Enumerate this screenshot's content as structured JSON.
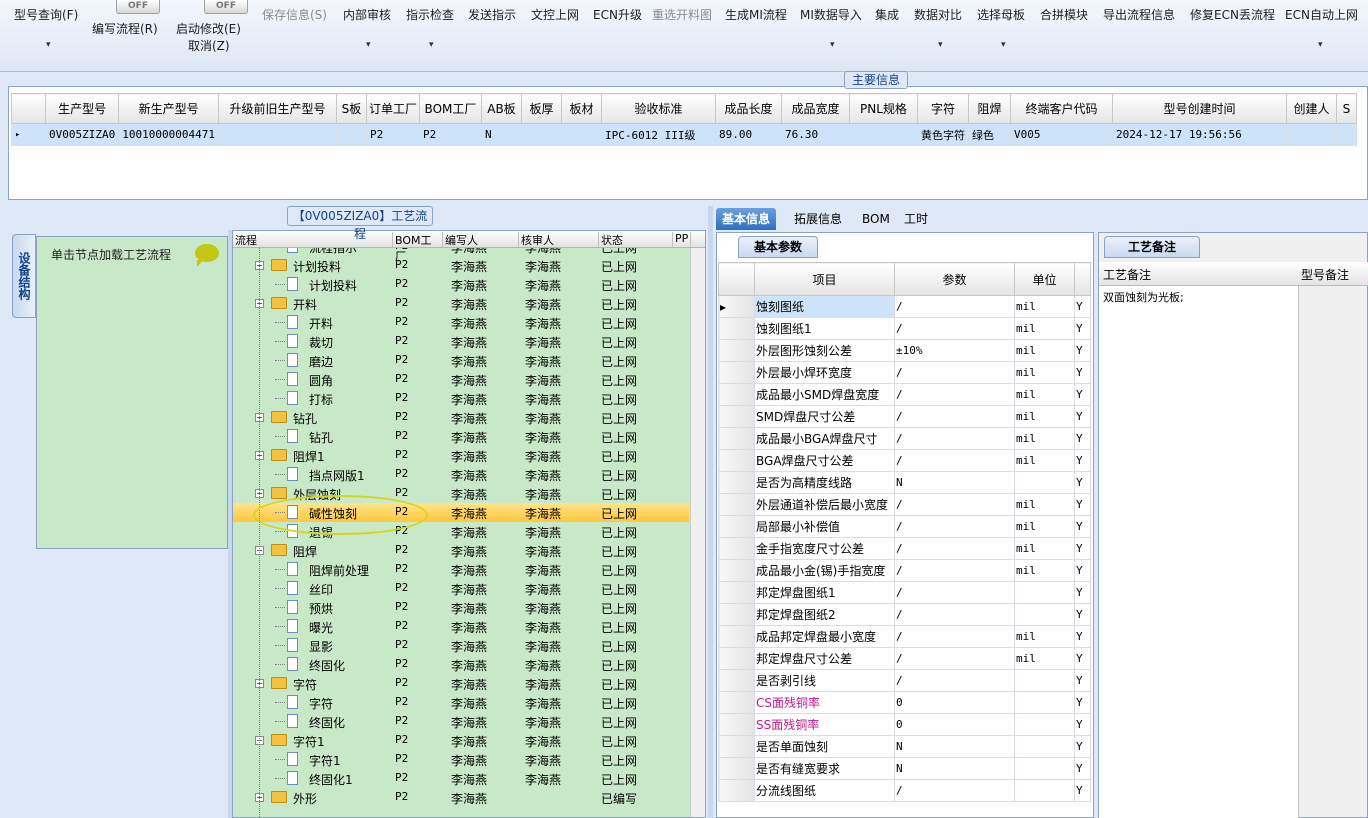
{
  "toolbar": {
    "items": [
      {
        "label": "型号查询(F)",
        "disabled": false
      },
      {
        "label": "编写流程(R)",
        "disabled": false
      },
      {
        "label": "启动修改(E)",
        "disabled": false
      },
      {
        "label": "取消(Z)",
        "disabled": false
      },
      {
        "label": "保存信息(S)",
        "disabled": true
      },
      {
        "label": "内部审核",
        "disabled": false
      },
      {
        "label": "指示检查",
        "disabled": false
      },
      {
        "label": "发送指示",
        "disabled": false
      },
      {
        "label": "文控上网",
        "disabled": false
      },
      {
        "label": "ECN升级",
        "disabled": false
      },
      {
        "label": "重选开料图",
        "disabled": true
      },
      {
        "label": "生成MI流程",
        "disabled": false
      },
      {
        "label": "MI数据导入",
        "disabled": false
      },
      {
        "label": "集成",
        "disabled": false
      },
      {
        "label": "数据对比",
        "disabled": false
      },
      {
        "label": "选择母板",
        "disabled": false
      },
      {
        "label": "合拼模块",
        "disabled": false
      },
      {
        "label": "导出流程信息",
        "disabled": false
      },
      {
        "label": "修复ECN丢流程",
        "disabled": false
      },
      {
        "label": "ECN自动上网",
        "disabled": false
      }
    ],
    "toggle_label": "OFF",
    "dropdown_glyph": "▾"
  },
  "main_info": {
    "title": "主要信息",
    "columns": [
      "生产型号",
      "新生产型号",
      "升级前旧生产型号",
      "S板",
      "订单工厂",
      "BOM工厂",
      "AB板",
      "板厚",
      "板材",
      "验收标准",
      "成品长度",
      "成品宽度",
      "PNL规格",
      "字符",
      "阻焊",
      "终端客户代码",
      "型号创建时间",
      "创建人",
      "S"
    ],
    "row": [
      "0V005ZIZA0",
      "10010000004471",
      "",
      "",
      "P2",
      "P2",
      "N",
      "",
      "",
      "IPC-6012 III级",
      "89.00",
      "76.30",
      "",
      "黄色字符",
      "绿色",
      "V005",
      "2024-12-17 19:56:56",
      "",
      ""
    ]
  },
  "process": {
    "title": "【0V005ZIZA0】工艺流程",
    "side_tab": "设备结构",
    "hint": "单击节点加载工艺流程",
    "columns": [
      "流程",
      "BOM工厂",
      "编写人",
      "核审人",
      "状态",
      "PP"
    ],
    "rows": [
      {
        "name": "流程指示",
        "type": "doc",
        "factory": "P2",
        "writer": "李海燕",
        "reviewer": "李海燕",
        "status": "已上网"
      },
      {
        "name": "计划投料",
        "type": "folder",
        "factory": "P2",
        "writer": "李海燕",
        "reviewer": "李海燕",
        "status": "已上网"
      },
      {
        "name": "计划投料",
        "type": "doc",
        "factory": "P2",
        "writer": "李海燕",
        "reviewer": "李海燕",
        "status": "已上网"
      },
      {
        "name": "开料",
        "type": "folder",
        "factory": "P2",
        "writer": "李海燕",
        "reviewer": "李海燕",
        "status": "已上网"
      },
      {
        "name": "开料",
        "type": "doc",
        "factory": "P2",
        "writer": "李海燕",
        "reviewer": "李海燕",
        "status": "已上网"
      },
      {
        "name": "裁切",
        "type": "doc",
        "factory": "P2",
        "writer": "李海燕",
        "reviewer": "李海燕",
        "status": "已上网"
      },
      {
        "name": "磨边",
        "type": "doc",
        "factory": "P2",
        "writer": "李海燕",
        "reviewer": "李海燕",
        "status": "已上网"
      },
      {
        "name": "圆角",
        "type": "doc",
        "factory": "P2",
        "writer": "李海燕",
        "reviewer": "李海燕",
        "status": "已上网"
      },
      {
        "name": "打标",
        "type": "doc",
        "factory": "P2",
        "writer": "李海燕",
        "reviewer": "李海燕",
        "status": "已上网"
      },
      {
        "name": "钻孔",
        "type": "folder",
        "factory": "P2",
        "writer": "李海燕",
        "reviewer": "李海燕",
        "status": "已上网"
      },
      {
        "name": "钻孔",
        "type": "doc",
        "factory": "P2",
        "writer": "李海燕",
        "reviewer": "李海燕",
        "status": "已上网"
      },
      {
        "name": "阻焊1",
        "type": "folder",
        "factory": "P2",
        "writer": "李海燕",
        "reviewer": "李海燕",
        "status": "已上网"
      },
      {
        "name": "挡点网版1",
        "type": "doc",
        "factory": "P2",
        "writer": "李海燕",
        "reviewer": "李海燕",
        "status": "已上网"
      },
      {
        "name": "外层蚀刻",
        "type": "folder",
        "factory": "P2",
        "writer": "李海燕",
        "reviewer": "李海燕",
        "status": "已上网"
      },
      {
        "name": "碱性蚀刻",
        "type": "doc",
        "factory": "P2",
        "writer": "李海燕",
        "reviewer": "李海燕",
        "status": "已上网",
        "selected": true
      },
      {
        "name": "退锡",
        "type": "doc",
        "factory": "P2",
        "writer": "李海燕",
        "reviewer": "李海燕",
        "status": "已上网"
      },
      {
        "name": "阻焊",
        "type": "folder",
        "factory": "P2",
        "writer": "李海燕",
        "reviewer": "李海燕",
        "status": "已上网"
      },
      {
        "name": "阻焊前处理",
        "type": "doc",
        "factory": "P2",
        "writer": "李海燕",
        "reviewer": "李海燕",
        "status": "已上网"
      },
      {
        "name": "丝印",
        "type": "doc",
        "factory": "P2",
        "writer": "李海燕",
        "reviewer": "李海燕",
        "status": "已上网"
      },
      {
        "name": "预烘",
        "type": "doc",
        "factory": "P2",
        "writer": "李海燕",
        "reviewer": "李海燕",
        "status": "已上网"
      },
      {
        "name": "曝光",
        "type": "doc",
        "factory": "P2",
        "writer": "李海燕",
        "reviewer": "李海燕",
        "status": "已上网"
      },
      {
        "name": "显影",
        "type": "doc",
        "factory": "P2",
        "writer": "李海燕",
        "reviewer": "李海燕",
        "status": "已上网"
      },
      {
        "name": "终固化",
        "type": "doc",
        "factory": "P2",
        "writer": "李海燕",
        "reviewer": "李海燕",
        "status": "已上网"
      },
      {
        "name": "字符",
        "type": "folder",
        "factory": "P2",
        "writer": "李海燕",
        "reviewer": "李海燕",
        "status": "已上网"
      },
      {
        "name": "字符",
        "type": "doc",
        "factory": "P2",
        "writer": "李海燕",
        "reviewer": "李海燕",
        "status": "已上网"
      },
      {
        "name": "终固化",
        "type": "doc",
        "factory": "P2",
        "writer": "李海燕",
        "reviewer": "李海燕",
        "status": "已上网"
      },
      {
        "name": "字符1",
        "type": "folder",
        "factory": "P2",
        "writer": "李海燕",
        "reviewer": "李海燕",
        "status": "已上网"
      },
      {
        "name": "字符1",
        "type": "doc",
        "factory": "P2",
        "writer": "李海燕",
        "reviewer": "李海燕",
        "status": "已上网"
      },
      {
        "name": "终固化1",
        "type": "doc",
        "factory": "P2",
        "writer": "李海燕",
        "reviewer": "李海燕",
        "status": "已上网"
      },
      {
        "name": "外形",
        "type": "folder",
        "factory": "P2",
        "writer": "李海燕",
        "reviewer": "",
        "status": "已编写"
      }
    ]
  },
  "tabs": [
    "基本信息",
    "拓展信息",
    "BOM",
    "工时"
  ],
  "basic_params": {
    "title": "基本参数",
    "columns": [
      "项目",
      "参数",
      "单位",
      ""
    ],
    "rows": [
      {
        "item": "蚀刻图纸",
        "value": "/",
        "unit": "mil",
        "flag": "Y"
      },
      {
        "item": "蚀刻图纸1",
        "value": "/",
        "unit": "mil",
        "flag": "Y"
      },
      {
        "item": "外层图形蚀刻公差",
        "value": "±10%",
        "unit": "mil",
        "flag": "Y"
      },
      {
        "item": "外层最小焊环宽度",
        "value": "/",
        "unit": "mil",
        "flag": "Y"
      },
      {
        "item": "成品最小SMD焊盘宽度",
        "value": "/",
        "unit": "mil",
        "flag": "Y"
      },
      {
        "item": "SMD焊盘尺寸公差",
        "value": "/",
        "unit": "mil",
        "flag": "Y"
      },
      {
        "item": "成品最小BGA焊盘尺寸",
        "value": "/",
        "unit": "mil",
        "flag": "Y"
      },
      {
        "item": "BGA焊盘尺寸公差",
        "value": "/",
        "unit": "mil",
        "flag": "Y"
      },
      {
        "item": "是否为高精度线路",
        "value": "N",
        "unit": "",
        "flag": "Y"
      },
      {
        "item": "外层通道补偿后最小宽度",
        "value": "/",
        "unit": "mil",
        "flag": "Y"
      },
      {
        "item": "局部最小补偿值",
        "value": "/",
        "unit": "mil",
        "flag": "Y"
      },
      {
        "item": "金手指宽度尺寸公差",
        "value": "/",
        "unit": "mil",
        "flag": "Y"
      },
      {
        "item": "成品最小金(锡)手指宽度",
        "value": "/",
        "unit": "mil",
        "flag": "Y"
      },
      {
        "item": "邦定焊盘图纸1",
        "value": "/",
        "unit": "",
        "flag": "Y"
      },
      {
        "item": "邦定焊盘图纸2",
        "value": "/",
        "unit": "",
        "flag": "Y"
      },
      {
        "item": "成品邦定焊盘最小宽度",
        "value": "/",
        "unit": "mil",
        "flag": "Y"
      },
      {
        "item": "邦定焊盘尺寸公差",
        "value": "/",
        "unit": "mil",
        "flag": "Y"
      },
      {
        "item": "是否剥引线",
        "value": "/",
        "unit": "",
        "flag": "Y"
      },
      {
        "item": "CS面残铜率",
        "value": "0",
        "unit": "",
        "flag": "Y",
        "pink": true
      },
      {
        "item": "SS面残铜率",
        "value": "0",
        "unit": "",
        "flag": "Y",
        "pink": true
      },
      {
        "item": "是否单面蚀刻",
        "value": "N",
        "unit": "",
        "flag": "Y"
      },
      {
        "item": "是否有缝宽要求",
        "value": "N",
        "unit": "",
        "flag": "Y"
      },
      {
        "item": "分流线图纸",
        "value": "/",
        "unit": "",
        "flag": "Y"
      }
    ]
  },
  "remarks": {
    "title": "工艺备注",
    "col1": "工艺备注",
    "col2": "型号备注",
    "text": "双面蚀刻为光板;"
  },
  "colors": {
    "accent": "#2e6fc0",
    "tree_bg": "#c8e9c8",
    "selected": "#ffc83c",
    "pink": "#c2188c"
  }
}
